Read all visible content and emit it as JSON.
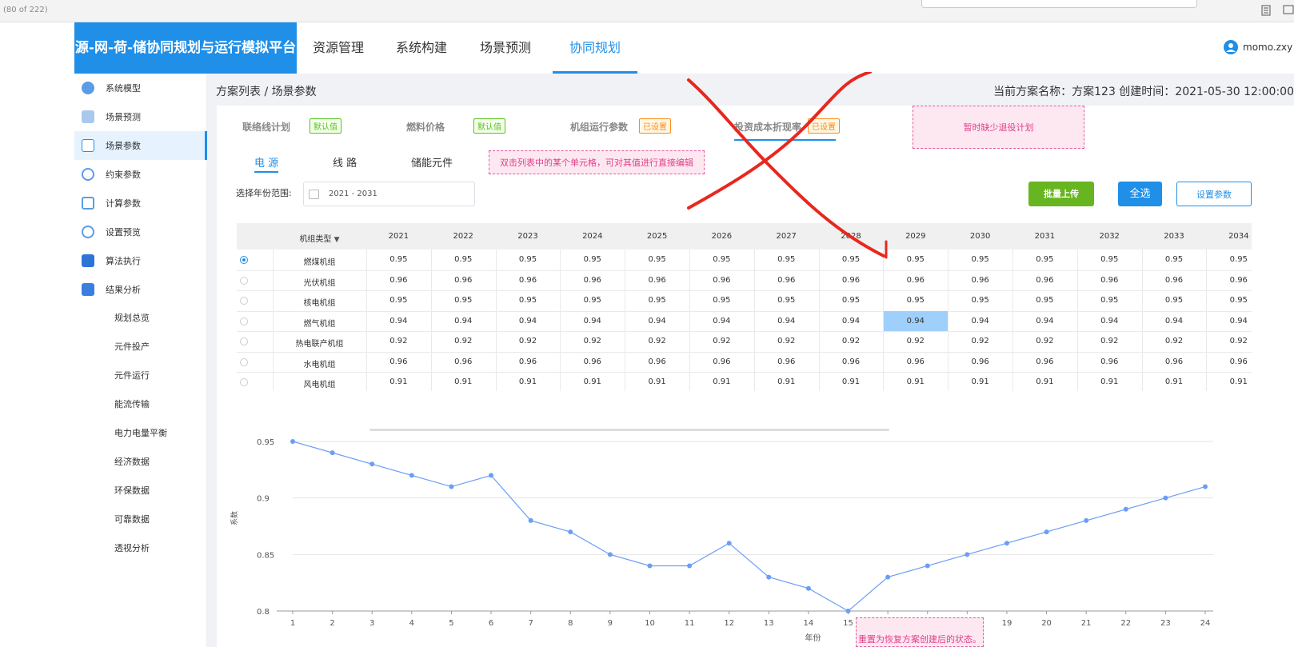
{
  "viewer": {
    "page_info": "(80 of 222)"
  },
  "app": {
    "title": "源-网-荷-储协同规划与运行模拟平台"
  },
  "topnav": {
    "tabs": [
      {
        "label": "资源管理"
      },
      {
        "label": "系统构建"
      },
      {
        "label": "场景预测"
      },
      {
        "label": "协同规划"
      }
    ],
    "active_index": 3
  },
  "user": {
    "name": "momo.zxy"
  },
  "sidebar": {
    "items": [
      {
        "label": "系统模型",
        "icon": "globe-icon"
      },
      {
        "label": "场景预测",
        "icon": "bar-chart-icon"
      },
      {
        "label": "场景参数",
        "icon": "calendar-icon"
      },
      {
        "label": "约束参数",
        "icon": "hexagon-icon"
      },
      {
        "label": "计算参数",
        "icon": "grid-icon"
      },
      {
        "label": "设置预览",
        "icon": "pie-icon"
      },
      {
        "label": "算法执行",
        "icon": "cube-icon"
      },
      {
        "label": "结果分析",
        "icon": "document-icon"
      }
    ],
    "active_index": 2,
    "sub_items": [
      "规划总览",
      "元件投产",
      "元件运行",
      "能流传输",
      "电力电量平衡",
      "经济数据",
      "环保数据",
      "可靠数据",
      "透视分析"
    ]
  },
  "breadcrumb": "方案列表 / 场景参数",
  "plan_info": "当前方案名称：方案123    创建时间：2021-05-30 12:00:00",
  "param_tabs": [
    {
      "label": "联络线计划",
      "badge": "默认值",
      "badge_type": "green"
    },
    {
      "label": "燃料价格",
      "badge": "默认值",
      "badge_type": "green"
    },
    {
      "label": "机组运行参数",
      "badge": "已设置",
      "badge_type": "orange"
    },
    {
      "label": "投资成本折现率",
      "badge": "已设置",
      "badge_type": "orange"
    }
  ],
  "notes": {
    "retire": "暂时缺少退役计划",
    "edit_hint": "双击列表中的某个单元格，可对其值进行直接编辑",
    "reset_hint": "重置为恢复方案创建后的状态。"
  },
  "sub_tabs": [
    "电 源",
    "线 路",
    "储能元件"
  ],
  "filter": {
    "label": "选择年份范围:",
    "value": "2021 - 2031"
  },
  "buttons": {
    "upload": "批量上传",
    "select_all": "全选",
    "set_params": "设置参数"
  },
  "table": {
    "type_header": "机组类型",
    "years": [
      "2021",
      "2022",
      "2023",
      "2024",
      "2025",
      "2026",
      "2027",
      "2028",
      "2029",
      "2030",
      "2031",
      "2032",
      "2033",
      "2034"
    ],
    "rows": [
      {
        "type": "燃煤机组",
        "values": [
          "0.95",
          "0.95",
          "0.95",
          "0.95",
          "0.95",
          "0.95",
          "0.95",
          "0.95",
          "0.95",
          "0.95",
          "0.95",
          "0.95",
          "0.95",
          "0.95"
        ]
      },
      {
        "type": "光伏机组",
        "values": [
          "0.96",
          "0.96",
          "0.96",
          "0.96",
          "0.96",
          "0.96",
          "0.96",
          "0.96",
          "0.96",
          "0.96",
          "0.96",
          "0.96",
          "0.96",
          "0.96"
        ]
      },
      {
        "type": "核电机组",
        "values": [
          "0.95",
          "0.95",
          "0.95",
          "0.95",
          "0.95",
          "0.95",
          "0.95",
          "0.95",
          "0.95",
          "0.95",
          "0.95",
          "0.95",
          "0.95",
          "0.95"
        ]
      },
      {
        "type": "燃气机组",
        "values": [
          "0.94",
          "0.94",
          "0.94",
          "0.94",
          "0.94",
          "0.94",
          "0.94",
          "0.94",
          "0.94",
          "0.94",
          "0.94",
          "0.94",
          "0.94",
          "0.94"
        ]
      },
      {
        "type": "热电联产机组",
        "values": [
          "0.92",
          "0.92",
          "0.92",
          "0.92",
          "0.92",
          "0.92",
          "0.92",
          "0.92",
          "0.92",
          "0.92",
          "0.92",
          "0.92",
          "0.92",
          "0.92"
        ]
      },
      {
        "type": "水电机组",
        "values": [
          "0.96",
          "0.96",
          "0.96",
          "0.96",
          "0.96",
          "0.96",
          "0.96",
          "0.96",
          "0.96",
          "0.96",
          "0.96",
          "0.96",
          "0.96",
          "0.96"
        ]
      },
      {
        "type": "风电机组",
        "values": [
          "0.91",
          "0.91",
          "0.91",
          "0.91",
          "0.91",
          "0.91",
          "0.91",
          "0.91",
          "0.91",
          "0.91",
          "0.91",
          "0.91",
          "0.91",
          "0.91"
        ]
      }
    ],
    "selected_row": 0,
    "highlight": {
      "row": 3,
      "col": 8
    }
  },
  "colors": {
    "primary": "#1f8fe8",
    "green": "#67b520",
    "annotation_red": "#e8271f"
  },
  "chart_data": {
    "type": "line",
    "x": [
      1,
      2,
      3,
      4,
      5,
      6,
      7,
      8,
      9,
      10,
      11,
      12,
      13,
      14,
      15,
      16,
      17,
      18,
      19,
      20,
      21,
      22,
      23,
      24
    ],
    "series": [
      {
        "values": [
          0.95,
          0.94,
          0.93,
          0.92,
          0.91,
          0.92,
          0.88,
          0.87,
          0.85,
          0.84,
          0.84,
          0.86,
          0.83,
          0.82,
          0.8,
          0.83,
          0.84,
          0.85,
          0.86,
          0.87,
          0.88,
          0.89,
          0.9,
          0.91
        ]
      }
    ],
    "xlabel": "年份",
    "ylabel": "系数",
    "yticks": [
      "0.95",
      "0.9",
      "0.85",
      "0.8"
    ],
    "ylim": [
      0.8,
      0.95
    ],
    "grid": true,
    "color": "#6a9ef5"
  }
}
